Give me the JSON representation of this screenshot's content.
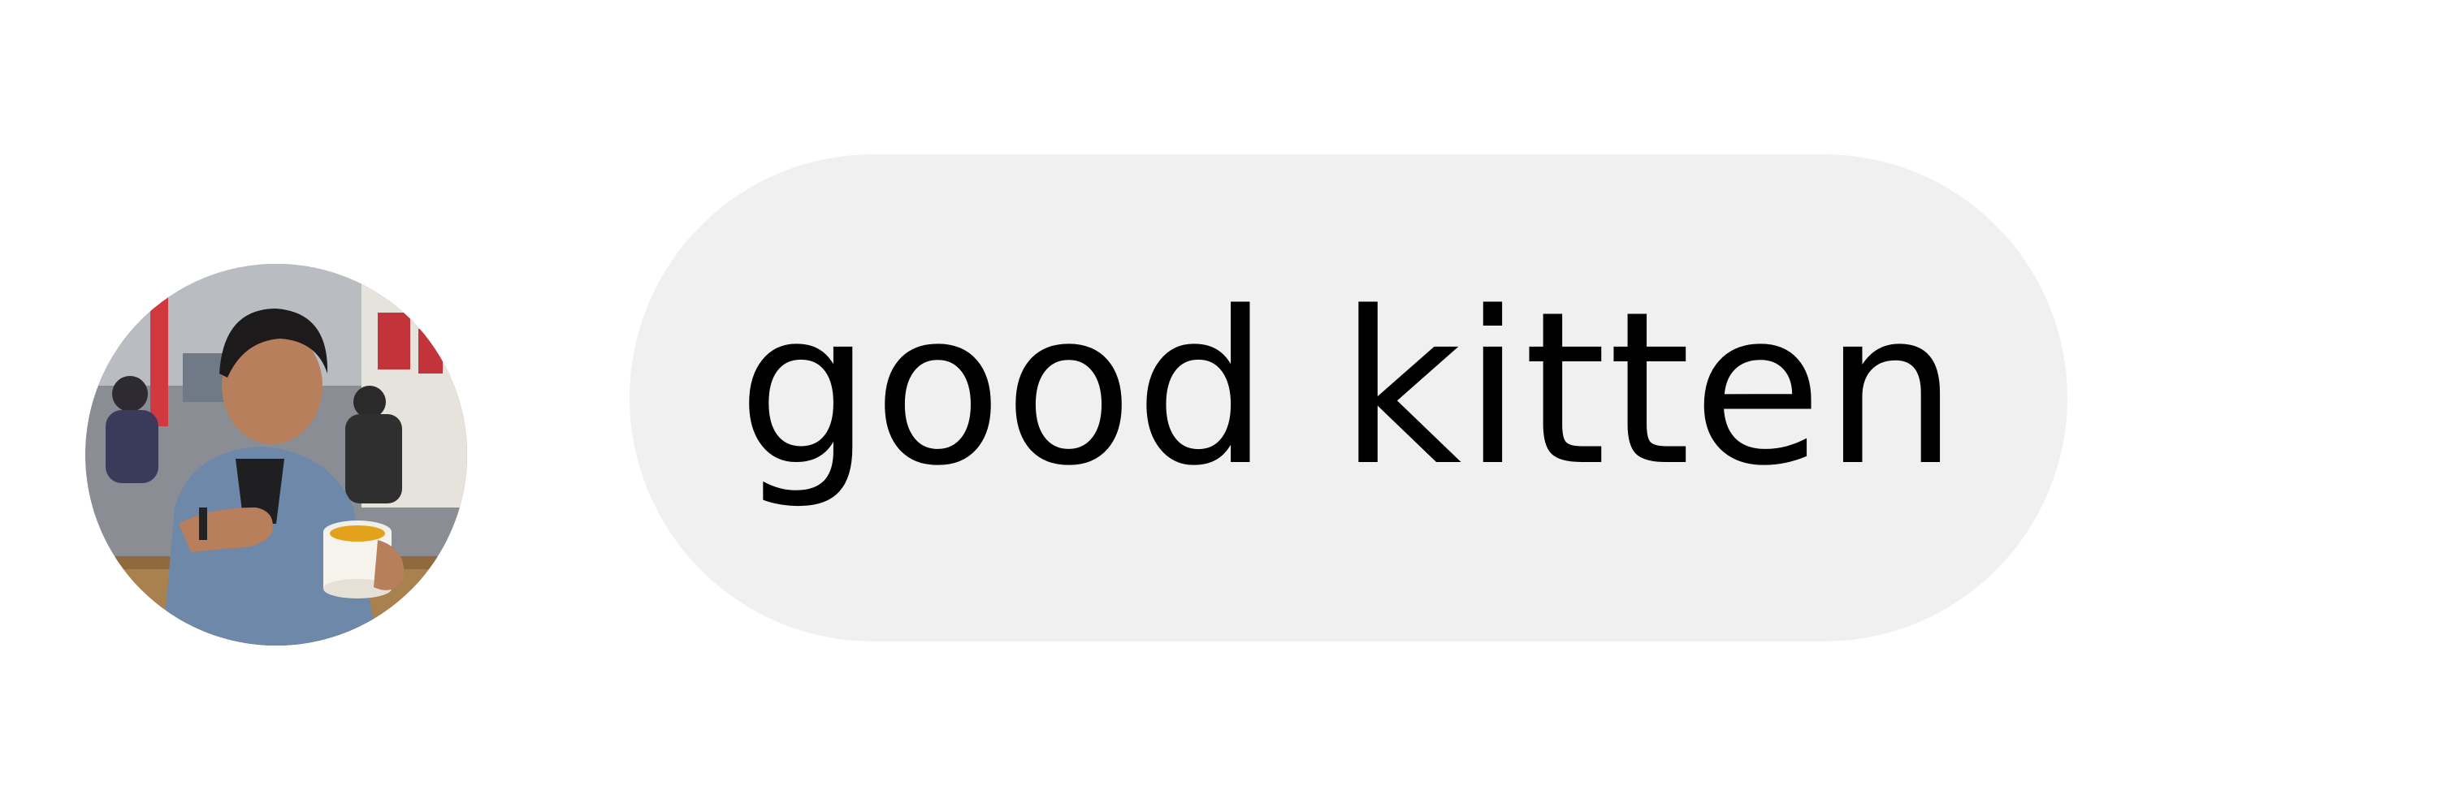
{
  "conversation": {
    "message": {
      "text": "good kitten"
    },
    "sender": {
      "avatar_icon": "user-avatar-photo"
    }
  },
  "colors": {
    "background": "#ffffff",
    "bubble": "#f0f0f0",
    "text": "#000000"
  }
}
